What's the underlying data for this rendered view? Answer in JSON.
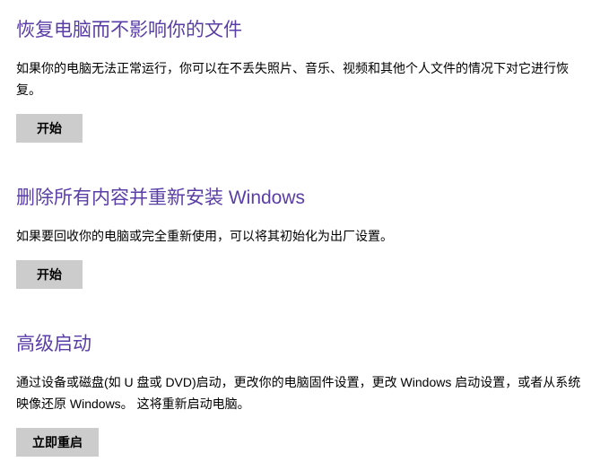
{
  "sections": [
    {
      "title": "恢复电脑而不影响你的文件",
      "desc": "如果你的电脑无法正常运行，你可以在不丢失照片、音乐、视频和其他个人文件的情况下对它进行恢复。",
      "button": "开始"
    },
    {
      "title": "删除所有内容并重新安装 Windows",
      "desc": "如果要回收你的电脑或完全重新使用，可以将其初始化为出厂设置。",
      "button": "开始"
    },
    {
      "title": "高级启动",
      "desc": "通过设备或磁盘(如 U 盘或 DVD)启动，更改你的电脑固件设置，更改 Windows 启动设置，或者从系统映像还原 Windows。  这将重新启动电脑。",
      "button": "立即重启"
    }
  ]
}
